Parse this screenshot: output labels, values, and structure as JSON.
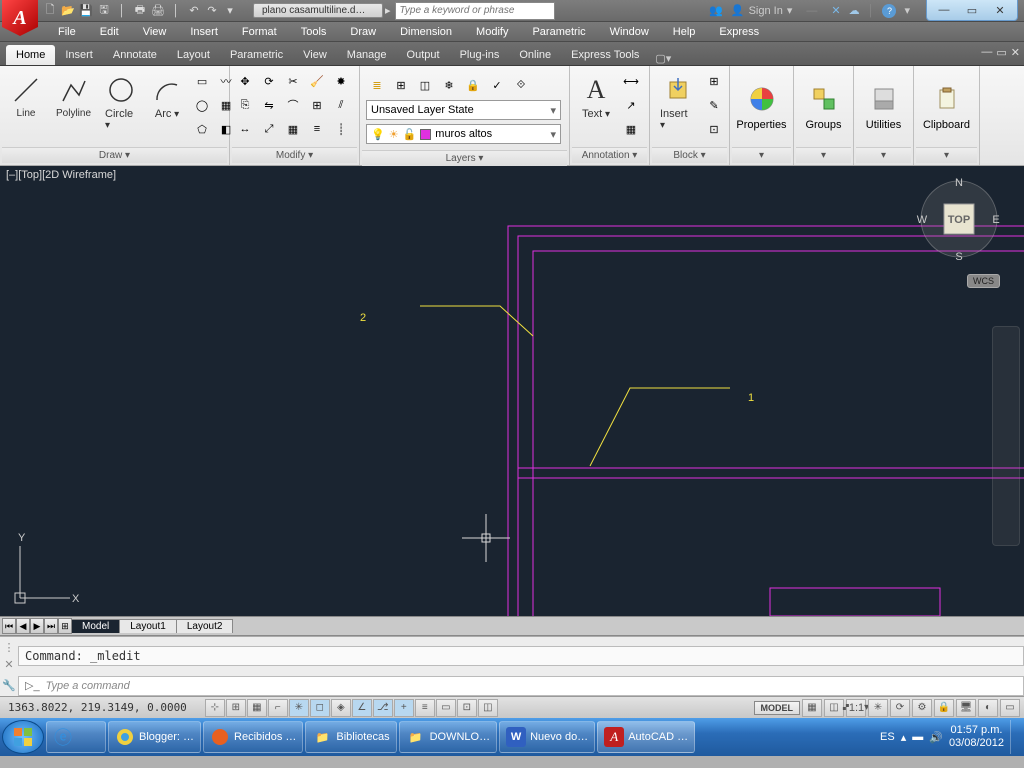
{
  "title": {
    "doc": "plano casamultiline.d…",
    "search_ph": "Type a keyword or phrase",
    "signin": "Sign In"
  },
  "menus": [
    "File",
    "Edit",
    "View",
    "Insert",
    "Format",
    "Tools",
    "Draw",
    "Dimension",
    "Modify",
    "Parametric",
    "Window",
    "Help",
    "Express"
  ],
  "tabs": [
    "Home",
    "Insert",
    "Annotate",
    "Layout",
    "Parametric",
    "View",
    "Manage",
    "Output",
    "Plug-ins",
    "Online",
    "Express Tools"
  ],
  "ribbon": {
    "draw": {
      "title": "Draw ▾",
      "btns": [
        "Line",
        "Polyline",
        "Circle",
        "Arc"
      ]
    },
    "modify": {
      "title": "Modify ▾"
    },
    "layers": {
      "title": "Layers ▾",
      "state": "Unsaved Layer State",
      "current": "muros altos"
    },
    "annotation": {
      "title": "Annotation ▾",
      "text": "Text"
    },
    "block": {
      "title": "Block ▾",
      "insert": "Insert"
    },
    "panels": [
      "Properties",
      "Groups",
      "Utilities",
      "Clipboard"
    ]
  },
  "viewport": {
    "label": "[–][Top][2D Wireframe]",
    "cube": {
      "n": "N",
      "s": "S",
      "e": "E",
      "w": "W",
      "top": "TOP"
    },
    "wcs": "WCS",
    "annot": {
      "a1": "1",
      "a2": "2"
    }
  },
  "ucs": {
    "y": "Y",
    "x": "X"
  },
  "layouts": {
    "tabs": [
      "Model",
      "Layout1",
      "Layout2"
    ]
  },
  "command": {
    "history": "Command: _mledit",
    "prompt_ph": "Type a command"
  },
  "status": {
    "coords": "1363.8022, 219.3149, 0.0000",
    "model": "MODEL",
    "scale": "1:1"
  },
  "taskbar": {
    "items": [
      {
        "label": "Blogger: …"
      },
      {
        "label": "Recibidos …"
      },
      {
        "label": "Bibliotecas"
      },
      {
        "label": "DOWNLO…"
      },
      {
        "label": "Nuevo do…"
      },
      {
        "label": "AutoCAD …"
      }
    ],
    "lang": "ES",
    "time": "01:57 p.m.",
    "date": "03/08/2012"
  }
}
